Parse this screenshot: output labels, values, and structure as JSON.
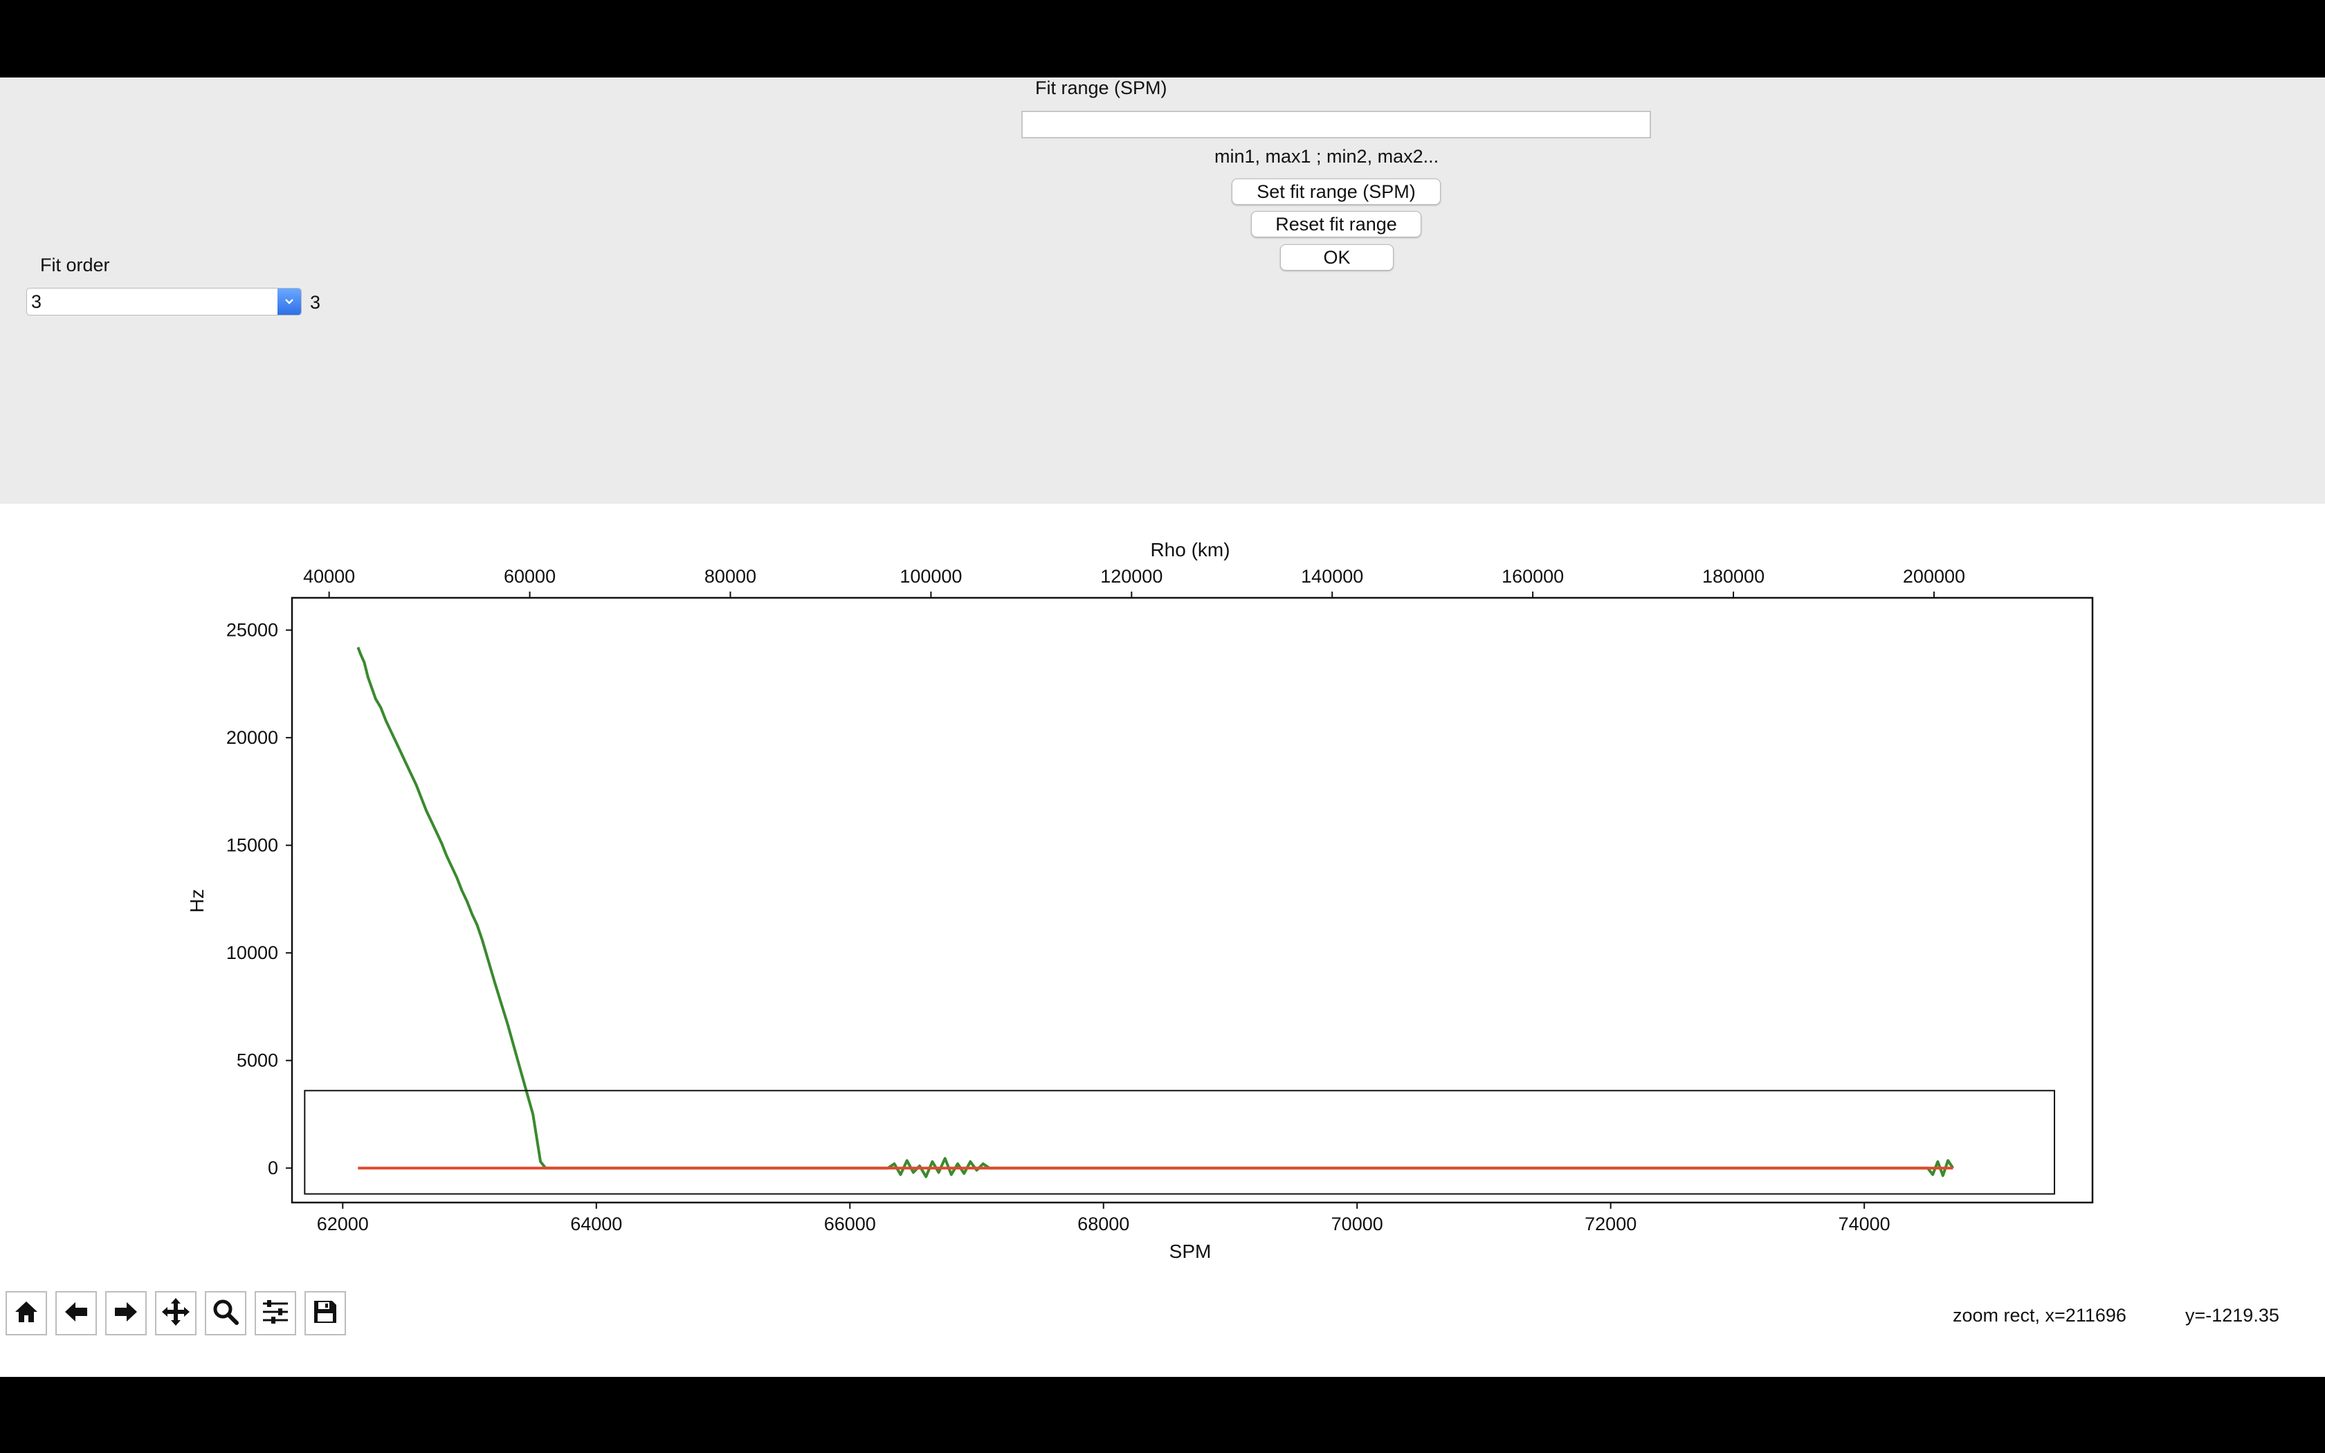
{
  "panel": {
    "fit_range_label": "Fit range (SPM)",
    "fit_range_value": "",
    "fit_range_hint": "min1, max1 ; min2, max2...",
    "set_fit_range_button": "Set fit range (SPM)",
    "reset_fit_range_button": "Reset fit range",
    "ok_button": "OK",
    "fit_order_label": "Fit order",
    "fit_order_selected": "3",
    "fit_order_display": "3"
  },
  "toolbar": {
    "icons": [
      "home-icon",
      "back-arrow-icon",
      "forward-arrow-icon",
      "pan-move-icon",
      "zoom-magnifier-icon",
      "configure-subplots-icon",
      "save-floppy-icon"
    ]
  },
  "status": {
    "coords": "zoom rect, x=211696",
    "y": "y=-1219.35"
  },
  "chart_data": {
    "type": "line",
    "xlabel": "SPM",
    "ylabel": "Hz",
    "top_xlabel": "Rho (km)",
    "xlim": [
      61600,
      75800
    ],
    "ylim": [
      -1600,
      26500
    ],
    "top_xlim": [
      36300,
      215800
    ],
    "xticks": [
      62000,
      64000,
      66000,
      68000,
      70000,
      72000,
      74000
    ],
    "yticks": [
      0,
      5000,
      10000,
      15000,
      20000,
      25000
    ],
    "top_xticks": [
      40000,
      60000,
      80000,
      100000,
      120000,
      140000,
      160000,
      180000,
      200000
    ],
    "series": [
      {
        "color": "#3a8a2e",
        "x": [
          62120,
          62140,
          62170,
          62200,
          62230,
          62260,
          62300,
          62340,
          62380,
          62420,
          62460,
          62500,
          62540,
          62580,
          62620,
          62660,
          62700,
          62740,
          62780,
          62820,
          62860,
          62900,
          62940,
          62980,
          63020,
          63060,
          63100,
          63200,
          63300,
          63400,
          63500,
          63560,
          63600,
          64500,
          65500,
          66300,
          66350,
          66400,
          66450,
          66500,
          66550,
          66600,
          66650,
          66700,
          66750,
          66800,
          66850,
          66900,
          66950,
          67000,
          67050,
          67100,
          68000,
          70000,
          72000,
          74000,
          74500,
          74540,
          74580,
          74620,
          74660,
          74700
        ],
        "y": [
          24200,
          23900,
          23500,
          22800,
          22300,
          21800,
          21400,
          20800,
          20300,
          19800,
          19300,
          18800,
          18300,
          17800,
          17200,
          16600,
          16100,
          15600,
          15100,
          14500,
          14000,
          13500,
          12900,
          12400,
          11800,
          11300,
          10600,
          8600,
          6700,
          4600,
          2500,
          300,
          0,
          0,
          0,
          0,
          200,
          -300,
          350,
          -200,
          100,
          -400,
          300,
          -200,
          450,
          -300,
          200,
          -250,
          300,
          -100,
          200,
          0,
          0,
          0,
          0,
          0,
          0,
          -300,
          300,
          -350,
          350,
          0
        ]
      },
      {
        "color": "#e04a2f",
        "x": [
          62120,
          74700
        ],
        "y": [
          0,
          0
        ]
      }
    ],
    "zoom_rect": {
      "x": [
        61700,
        75500
      ],
      "y": [
        -1200,
        3600
      ]
    }
  }
}
